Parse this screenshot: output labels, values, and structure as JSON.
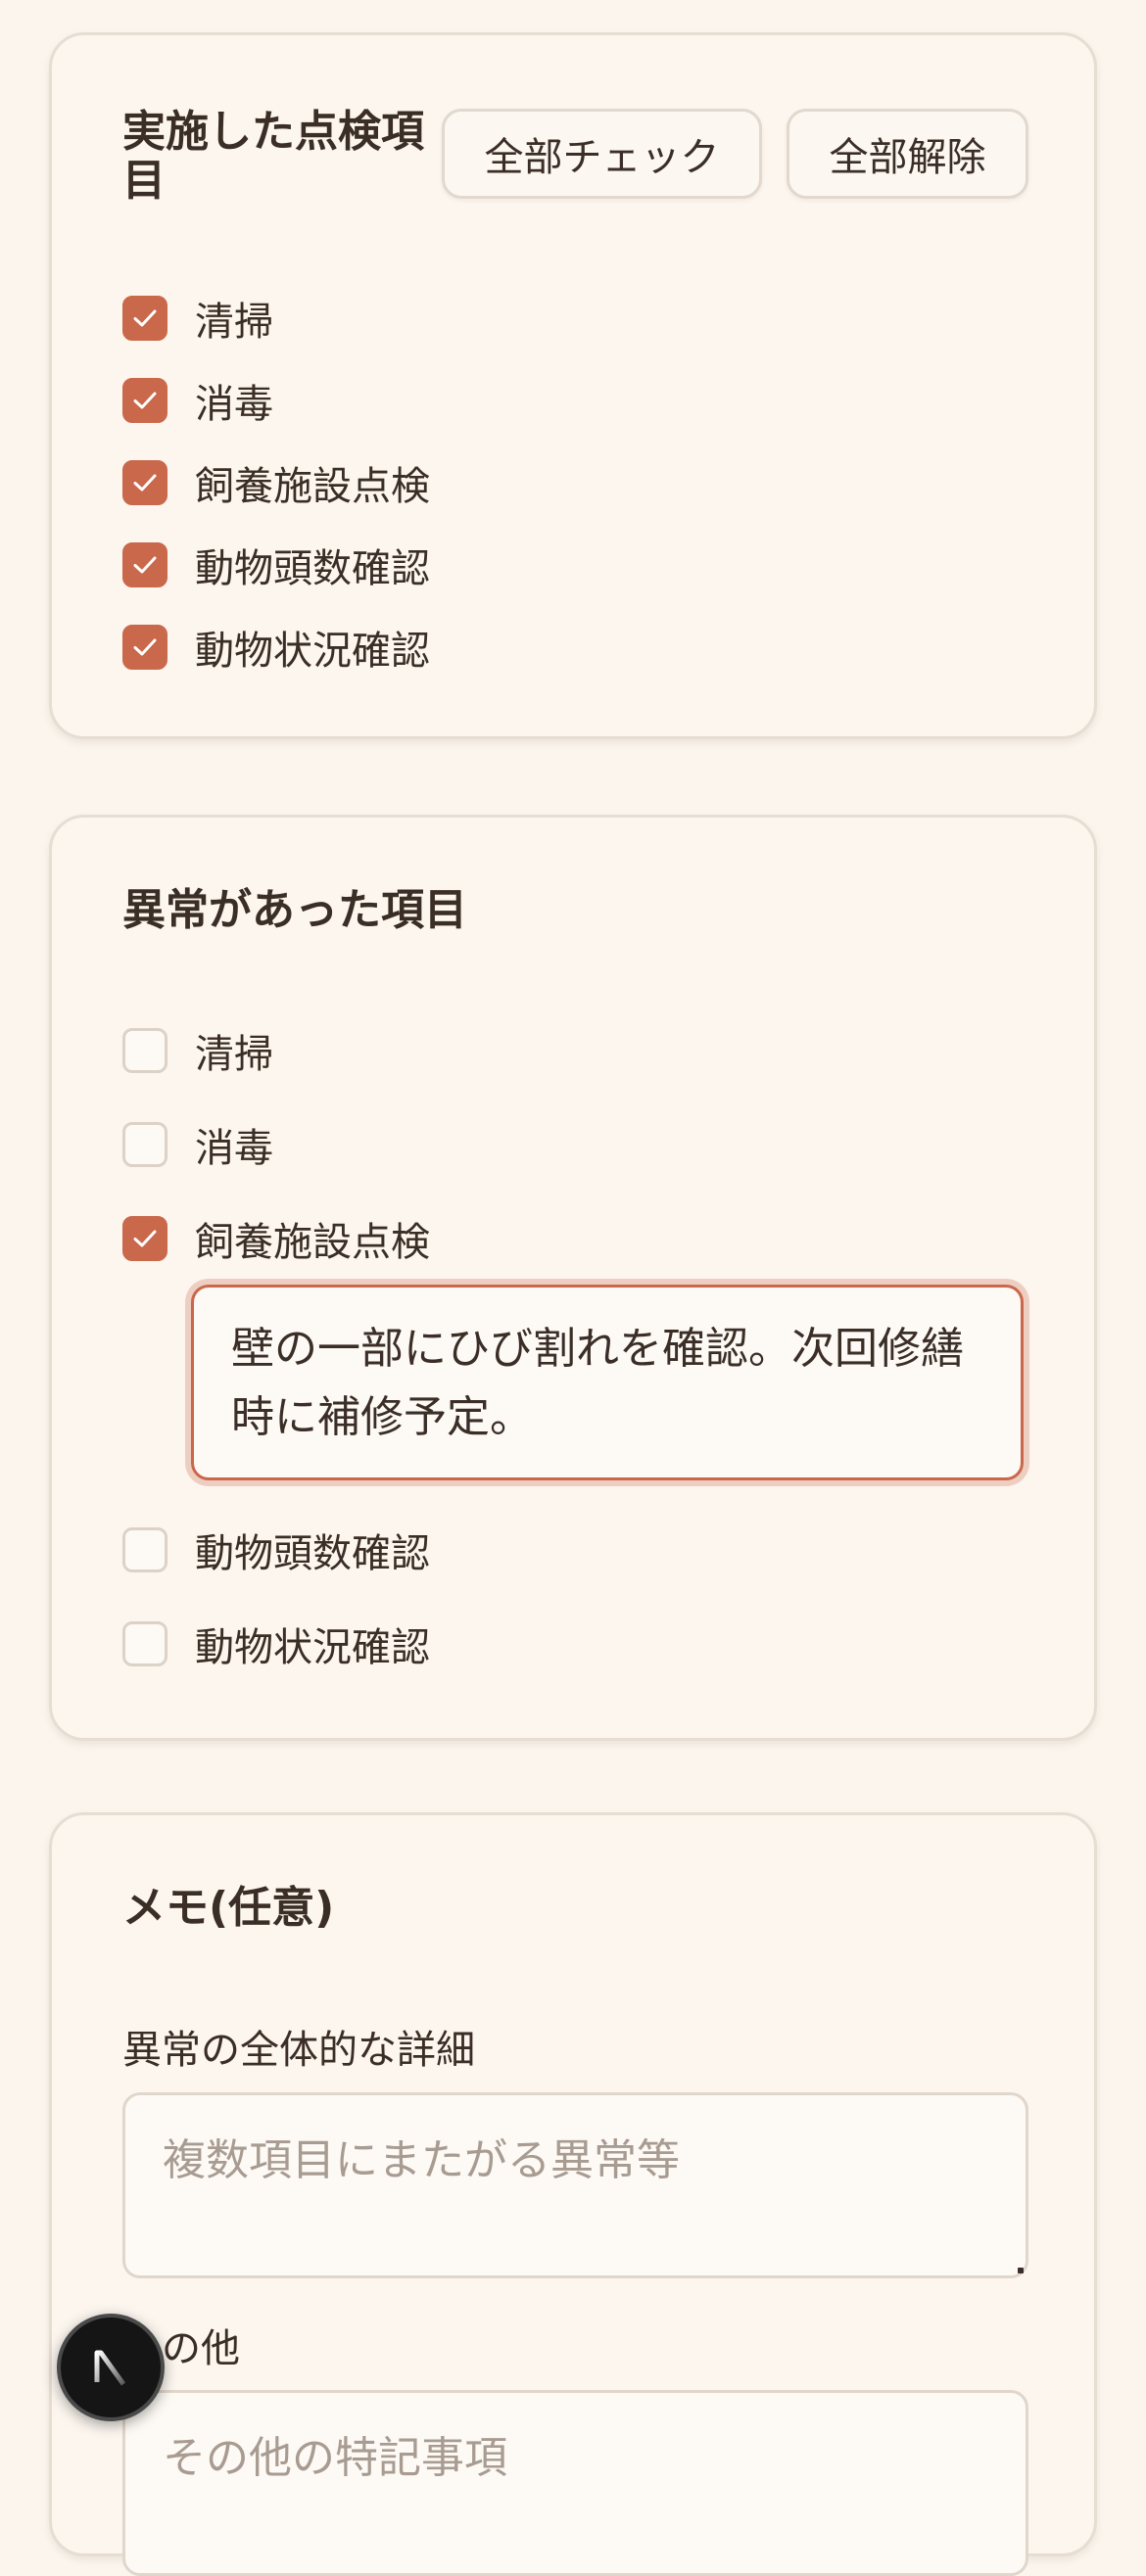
{
  "inspected_section": {
    "title": "実施した点検項目",
    "check_all_label": "全部チェック",
    "uncheck_all_label": "全部解除",
    "items": [
      {
        "label": "清掃",
        "checked": true
      },
      {
        "label": "消毒",
        "checked": true
      },
      {
        "label": "飼養施設点検",
        "checked": true
      },
      {
        "label": "動物頭数確認",
        "checked": true
      },
      {
        "label": "動物状況確認",
        "checked": true
      }
    ]
  },
  "abnormal_section": {
    "title": "異常があった項目",
    "items": [
      {
        "label": "清掃",
        "checked": false
      },
      {
        "label": "消毒",
        "checked": false
      },
      {
        "label": "飼養施設点検",
        "checked": true,
        "note": "壁の一部にひび割れを確認。次回修繕時に補修予定。"
      },
      {
        "label": "動物頭数確認",
        "checked": false
      },
      {
        "label": "動物状況確認",
        "checked": false
      }
    ]
  },
  "memo_section": {
    "title": "メモ(任意)",
    "detail_label": "異常の全体的な詳細",
    "detail_placeholder": "複数項目にまたがる異常等",
    "other_label": "その他",
    "other_placeholder": "その他の特記事項"
  },
  "badge": {
    "letter": "N",
    "icon": "nextjs-logo-icon"
  },
  "colors": {
    "accent": "#C9684A",
    "background": "#FBF5EE",
    "text": "#3A2E26",
    "placeholder": "#A89C92"
  }
}
